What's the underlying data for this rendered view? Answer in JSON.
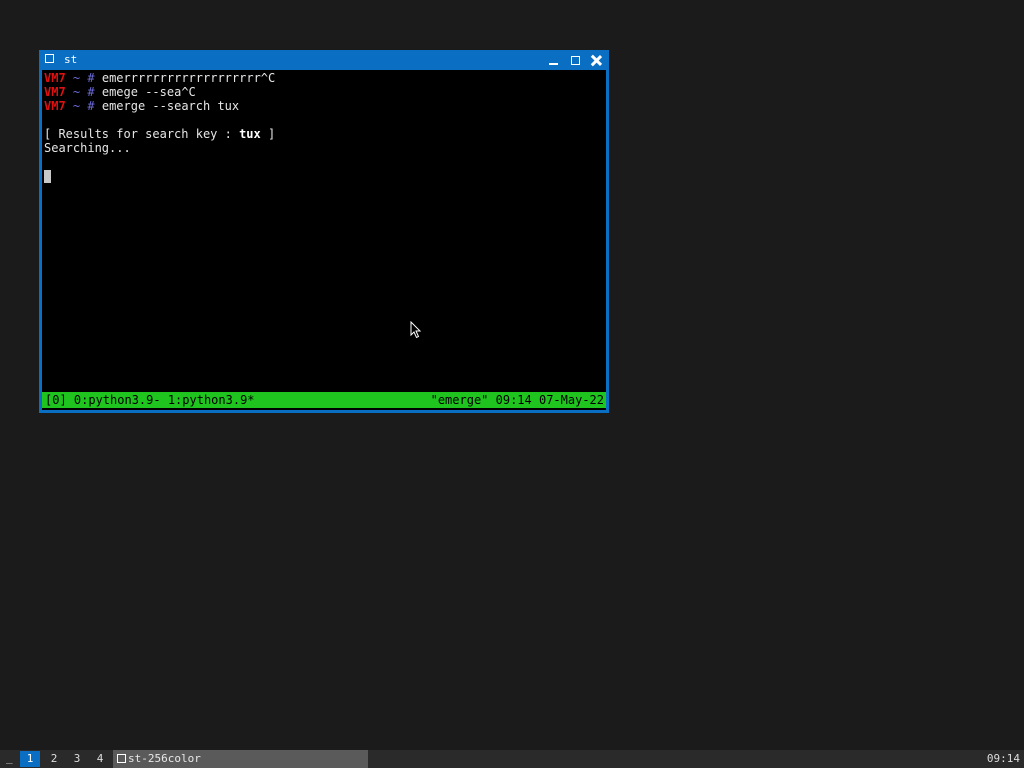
{
  "window": {
    "title": "st"
  },
  "terminal": {
    "lines": [
      {
        "host": "VM7",
        "tilde": "~",
        "hash": "#",
        "cmd": "emerrrrrrrrrrrrrrrrrrr^C"
      },
      {
        "host": "VM7",
        "tilde": "~",
        "hash": "#",
        "cmd": "emege --sea^C"
      },
      {
        "host": "VM7",
        "tilde": "~",
        "hash": "#",
        "cmd": "emerge --search tux"
      }
    ],
    "results_prefix": "[ Results for search key : ",
    "results_key": "tux",
    "results_suffix": " ]",
    "searching": "Searching..."
  },
  "tmux_status": {
    "left": "[0] 0:python3.9- 1:python3.9*",
    "right": "\"emerge\" 09:14 07-May-22"
  },
  "taskbar": {
    "menu": "_",
    "workspaces": [
      "1",
      "2",
      "3",
      "4"
    ],
    "active_workspace": "1",
    "task_label": "st-256color",
    "clock": "09:14"
  },
  "colors": {
    "window_border": "#0a6fc2",
    "terminal_bg": "#000000",
    "status_bg": "#1fc41f",
    "host_red": "#e01010",
    "desktop_bg": "#1b1b1b"
  },
  "icons": [
    "window-icon",
    "minimize-icon",
    "maximize-icon",
    "close-icon",
    "mouse-pointer-icon",
    "task-window-icon"
  ]
}
